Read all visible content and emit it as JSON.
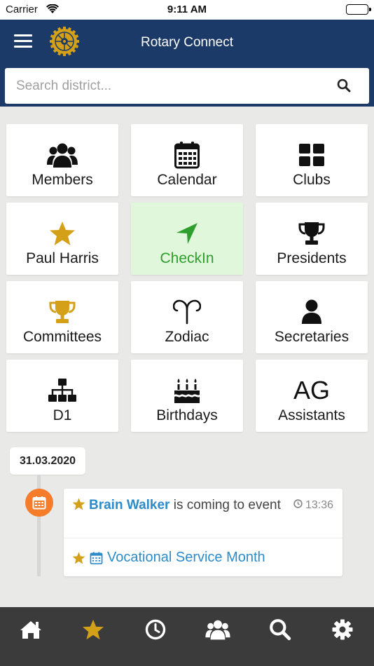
{
  "status_bar": {
    "carrier": "Carrier",
    "time": "9:11 AM"
  },
  "header": {
    "title": "Rotary Connect",
    "search_placeholder": "Search district..."
  },
  "tiles": [
    {
      "label": "Members",
      "icon": "users-icon"
    },
    {
      "label": "Calendar",
      "icon": "calendar-icon"
    },
    {
      "label": "Clubs",
      "icon": "grid-icon"
    },
    {
      "label": "Paul Harris",
      "icon": "star-icon"
    },
    {
      "label": "CheckIn",
      "icon": "location-arrow-icon",
      "active": true
    },
    {
      "label": "Presidents",
      "icon": "trophy-icon"
    },
    {
      "label": "Committees",
      "icon": "trophy-icon"
    },
    {
      "label": "Zodiac",
      "icon": "aries-icon"
    },
    {
      "label": "Secretaries",
      "icon": "user-icon"
    },
    {
      "label": "D1",
      "icon": "sitemap-icon"
    },
    {
      "label": "Birthdays",
      "icon": "birthday-cake-icon"
    },
    {
      "label": "Assistants",
      "icon_text": "AG"
    }
  ],
  "timeline": {
    "date": "31.03.2020",
    "event": {
      "person": "Brain Walker",
      "text": "is coming to event",
      "time": "13:36",
      "event_name": "Vocational Service Month"
    }
  },
  "tab_bar": [
    "home-icon",
    "star-icon",
    "clock-icon",
    "users-icon",
    "search-icon",
    "gear-icon"
  ],
  "colors": {
    "header": "#1c3a68",
    "accent_gold": "#d4a017",
    "active_tile": "#e1f7dc",
    "active_text": "#2e9e2e",
    "link": "#2d8bc9",
    "timeline_dot": "#f47c2a",
    "tab_bar": "#3b3b3b"
  }
}
